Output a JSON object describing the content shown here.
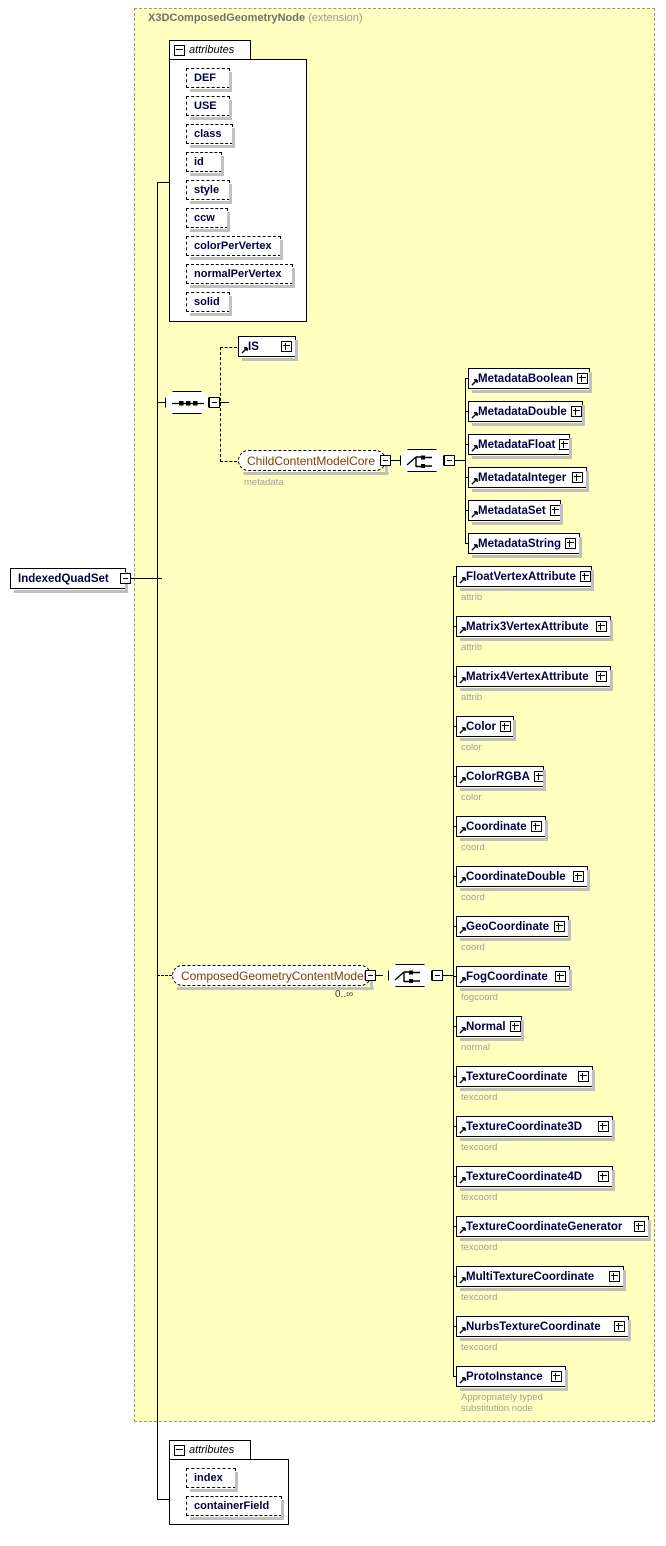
{
  "diagram": {
    "root_element": "IndexedQuadSet",
    "extension_base": "X3DComposedGeometryNode",
    "extension_kind": "(extension)",
    "attributes_label": "attributes",
    "occurrence": "0..∞",
    "icons": {
      "expand": "plus-icon",
      "collapse": "minus-icon",
      "sequence": "sequence-compositor-icon",
      "choice": "choice-compositor-icon",
      "substitution": "substitution-arrow-icon"
    }
  },
  "base_attributes": [
    {
      "name": "DEF",
      "width": 44
    },
    {
      "name": "USE",
      "width": 44
    },
    {
      "name": "class",
      "width": 47
    },
    {
      "name": "id",
      "width": 36
    },
    {
      "name": "style",
      "width": 44
    },
    {
      "name": "ccw",
      "width": 42
    },
    {
      "name": "colorPerVertex",
      "width": 95
    },
    {
      "name": "normalPerVertex",
      "width": 107
    },
    {
      "name": "solid",
      "width": 44
    }
  ],
  "own_attributes": [
    {
      "name": "index",
      "width": 50
    },
    {
      "name": "containerField",
      "width": 96
    }
  ],
  "core_children": {
    "is_element": {
      "name": "IS",
      "width": 58
    },
    "group_ref": {
      "name": "ChildContentModelCore",
      "caption": "metadata",
      "width": 148
    },
    "items": [
      {
        "name": "MetadataBoolean",
        "width": 122
      },
      {
        "name": "MetadataDouble",
        "width": 115
      },
      {
        "name": "MetadataFloat",
        "width": 102
      },
      {
        "name": "MetadataInteger",
        "width": 119
      },
      {
        "name": "MetadataSet",
        "width": 93
      },
      {
        "name": "MetadataString",
        "width": 112
      }
    ]
  },
  "geometry_content": {
    "group_ref": {
      "name": "ComposedGeometryContentModel",
      "width": 199
    },
    "items": [
      {
        "name": "FloatVertexAttribute",
        "caption": "attrib",
        "width": 136
      },
      {
        "name": "Matrix3VertexAttribute",
        "caption": "attrib",
        "width": 155
      },
      {
        "name": "Matrix4VertexAttribute",
        "caption": "attrib",
        "width": 155
      },
      {
        "name": "Color",
        "caption": "color",
        "width": 58
      },
      {
        "name": "ColorRGBA",
        "caption": "color",
        "width": 88
      },
      {
        "name": "Coordinate",
        "caption": "coord",
        "width": 90
      },
      {
        "name": "CoordinateDouble",
        "caption": "coord",
        "width": 132
      },
      {
        "name": "GeoCoordinate",
        "caption": "coord",
        "width": 113
      },
      {
        "name": "FogCoordinate",
        "caption": "fogcoord",
        "width": 114
      },
      {
        "name": "Normal",
        "caption": "normal",
        "width": 66
      },
      {
        "name": "TextureCoordinate",
        "caption": "texcoord",
        "width": 137
      },
      {
        "name": "TextureCoordinate3D",
        "caption": "texcoord",
        "width": 157
      },
      {
        "name": "TextureCoordinate4D",
        "caption": "texcoord",
        "width": 157
      },
      {
        "name": "TextureCoordinateGenerator",
        "caption": "texcoord",
        "width": 193
      },
      {
        "name": "MultiTextureCoordinate",
        "caption": "texcoord",
        "width": 168
      },
      {
        "name": "NurbsTextureCoordinate",
        "caption": "texcoord",
        "width": 173
      },
      {
        "name": "ProtoInstance",
        "caption": "Appropriately typed\nsubstitution node",
        "width": 110
      }
    ]
  }
}
